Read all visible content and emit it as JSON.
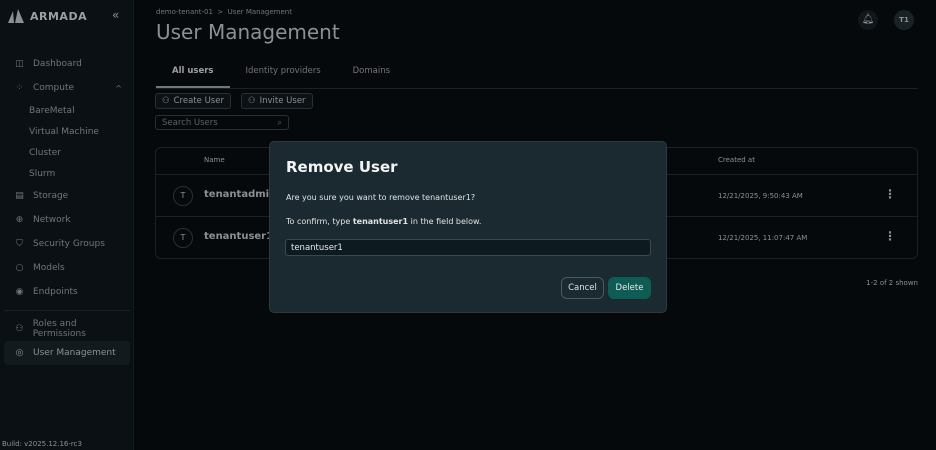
{
  "brand": {
    "name": "ARMADA",
    "collapse_icon": "chevrons-left-icon"
  },
  "sidebar": {
    "items": [
      {
        "label": "Dashboard",
        "icon": "layout-icon"
      },
      {
        "label": "Compute",
        "icon": "compute-icon",
        "expanded": true
      },
      {
        "label": "BareMetal"
      },
      {
        "label": "Virtual Machine"
      },
      {
        "label": "Cluster"
      },
      {
        "label": "Slurm"
      },
      {
        "label": "Storage",
        "icon": "storage-icon"
      },
      {
        "label": "Network",
        "icon": "globe-icon"
      },
      {
        "label": "Security Groups",
        "icon": "shield-lock-icon"
      },
      {
        "label": "Models",
        "icon": "flame-icon"
      },
      {
        "label": "Endpoints",
        "icon": "broadcast-icon"
      },
      {
        "label": "Roles and Permissions",
        "icon": "users-check-icon"
      },
      {
        "label": "User Management",
        "icon": "user-gear-icon",
        "active": true
      }
    ],
    "build": "Build: v2025.12.16-rc3"
  },
  "header": {
    "breadcrumb": [
      "demo-tenant-01",
      "User Management"
    ],
    "title": "User Management",
    "avatar": "T1"
  },
  "tabs": [
    "All users",
    "Identity providers",
    "Domains"
  ],
  "toolbar": {
    "create": "Create User",
    "invite": "Invite User",
    "search_placeholder": "Search Users"
  },
  "table": {
    "columns": {
      "name": "Name",
      "created": "Created at"
    },
    "rows": [
      {
        "initial": "T",
        "name": "tenantadmin1",
        "created": "12/21/2025, 9:50:43 AM"
      },
      {
        "initial": "T",
        "name": "tenantuser1",
        "created": "12/21/2025, 11:07:47 AM"
      }
    ],
    "shown": "1-2 of 2 shown"
  },
  "modal": {
    "title": "Remove User",
    "question": "Are you sure you want to remove tenantuser1?",
    "confirm_prefix": "To confirm, type ",
    "confirm_name": "tenantuser1",
    "confirm_suffix": " in the field below.",
    "input_value": "tenantuser1",
    "cancel": "Cancel",
    "delete": "Delete"
  },
  "colors": {
    "accent": "#0f5c55",
    "modal_bg": "#1b2a30"
  }
}
